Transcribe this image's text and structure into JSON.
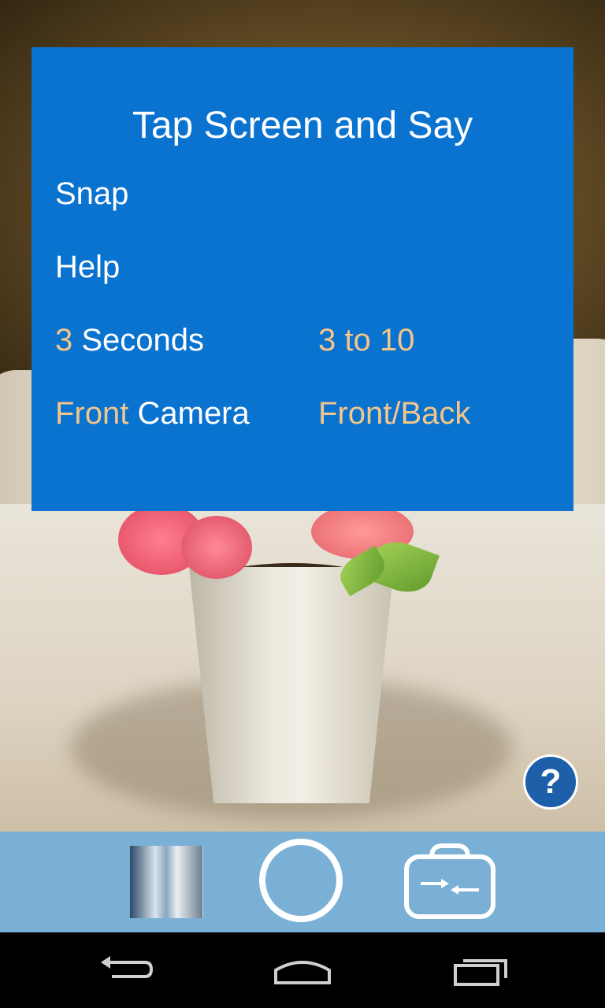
{
  "overlay": {
    "title": "Tap Screen and Say",
    "commands": [
      {
        "word": "Snap"
      },
      {
        "word": "Help"
      },
      {
        "prefix": "3",
        "word": "Seconds",
        "range": "3 to 10"
      },
      {
        "prefix": "Front",
        "word": "Camera",
        "range": "Front/Back"
      }
    ]
  },
  "help_button": {
    "label": "?"
  },
  "colors": {
    "overlay_bg": "#0a72cf",
    "highlight": "#f3c68a",
    "toolbar_bg": "#7ab0d6"
  },
  "icons": {
    "help": "question-mark-icon",
    "shutter": "shutter-ring-icon",
    "switch_camera": "switch-camera-icon",
    "back": "back-icon",
    "home": "home-icon",
    "recents": "recents-icon"
  }
}
